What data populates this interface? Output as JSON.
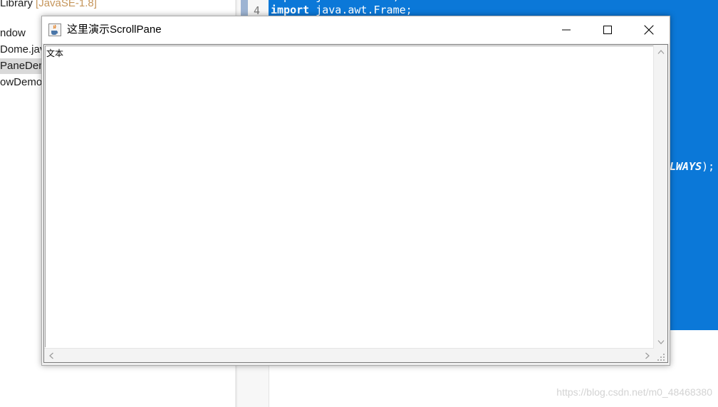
{
  "background": {
    "explorer": {
      "rows": [
        {
          "text": "Library ",
          "suffix": "[JavaSE-1.8]"
        },
        {
          "text": "ndow"
        },
        {
          "text": "Dome.java"
        },
        {
          "text": "PaneDemo"
        },
        {
          "text": "owDemo"
        }
      ]
    },
    "editor": {
      "line_number": "4",
      "code_line": {
        "keyword": "import",
        "rest": " java.awt.Frame;"
      },
      "partial_line": {
        "constant": "LWAYS",
        "tail": ");"
      }
    },
    "watermark": "https://blog.csdn.net/m0_48468380"
  },
  "window": {
    "title": "这里演示ScrollPane",
    "content_text": "文本",
    "icons": {
      "app": "java-cup-icon",
      "minimize": "minimize-icon",
      "maximize": "maximize-icon",
      "close": "close-icon"
    }
  },
  "colors": {
    "editor_selection": "#0b78d8",
    "library_label": "#c5955a",
    "selected_row": "#d9d9d9"
  }
}
